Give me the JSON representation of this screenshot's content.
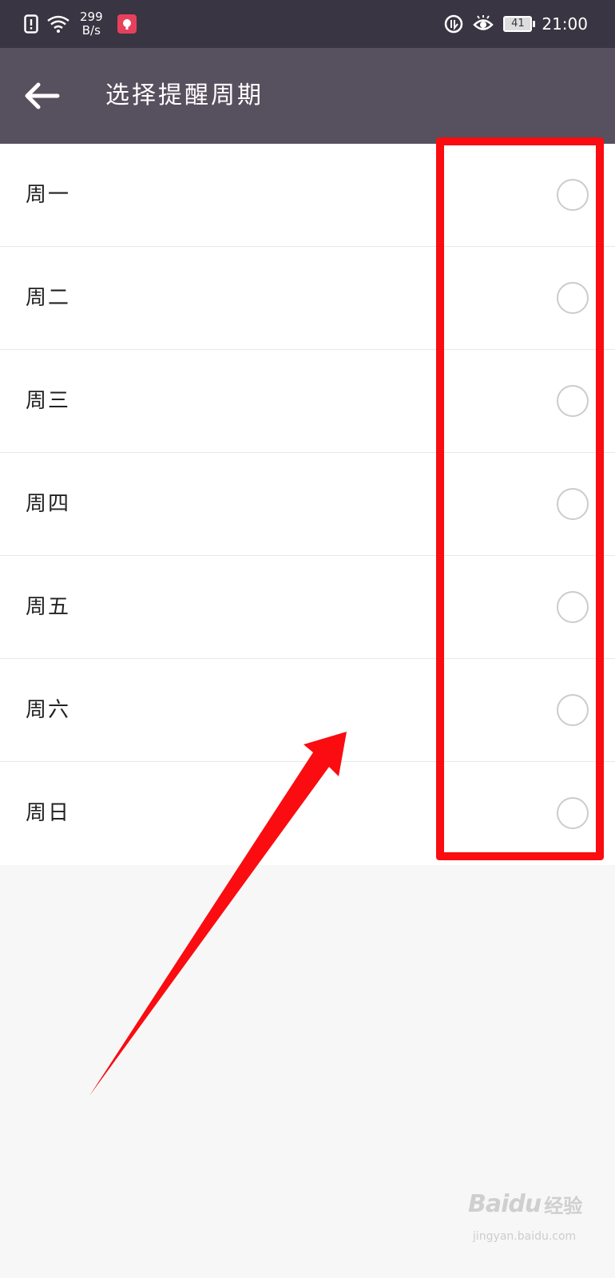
{
  "status_bar": {
    "net_speed_value": "299",
    "net_speed_unit": "B/s",
    "battery_level": "41",
    "time": "21:00",
    "icons": [
      "alert-icon",
      "wifi-icon",
      "app-notification-icon",
      "nfc-icon",
      "eye-comfort-icon",
      "battery-icon"
    ]
  },
  "header": {
    "title": "选择提醒周期",
    "back_icon": "back-arrow-icon"
  },
  "days": [
    {
      "label": "周一",
      "selected": false
    },
    {
      "label": "周二",
      "selected": false
    },
    {
      "label": "周三",
      "selected": false
    },
    {
      "label": "周四",
      "selected": false
    },
    {
      "label": "周五",
      "selected": false
    },
    {
      "label": "周六",
      "selected": false
    },
    {
      "label": "周日",
      "selected": false
    }
  ],
  "watermark": {
    "brand": "Baidu",
    "sub": "经验",
    "url": "jingyan.baidu.com"
  },
  "colors": {
    "status_bar": "#3a3542",
    "app_bar": "#57505f",
    "annotation": "#fa0c10",
    "radio_border": "#cccccc"
  }
}
